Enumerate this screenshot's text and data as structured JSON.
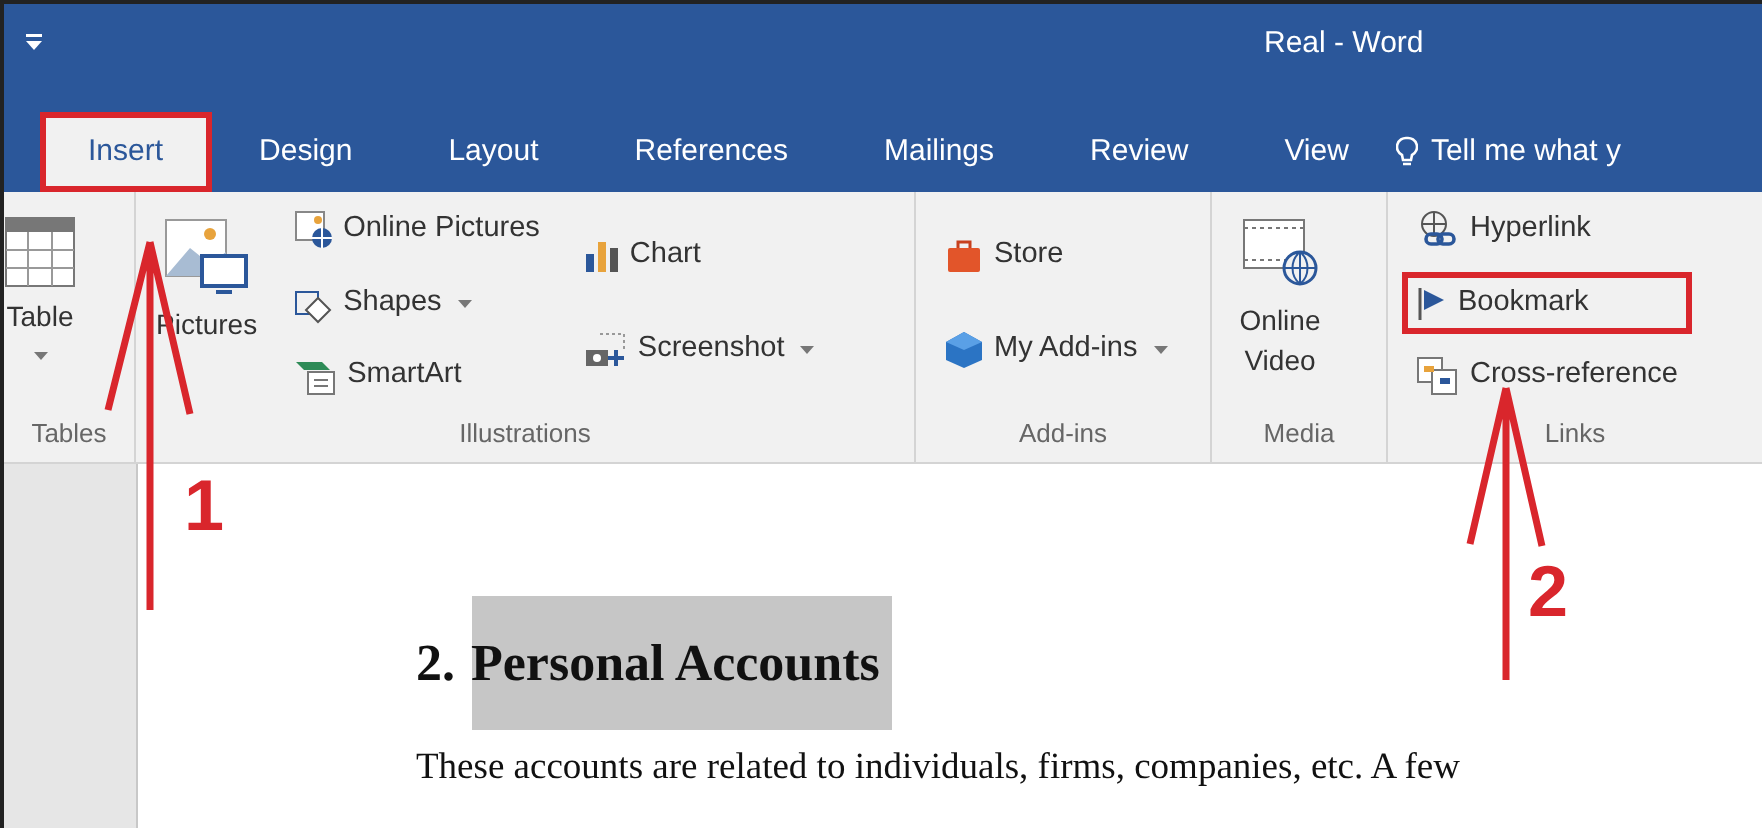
{
  "window": {
    "title": "Real - Word"
  },
  "tabs": [
    {
      "label": "Insert",
      "selected": true,
      "highlighted": true
    },
    {
      "label": "Design",
      "selected": false,
      "highlighted": false
    },
    {
      "label": "Layout",
      "selected": false,
      "highlighted": false
    },
    {
      "label": "References",
      "selected": false,
      "highlighted": false
    },
    {
      "label": "Mailings",
      "selected": false,
      "highlighted": false
    },
    {
      "label": "Review",
      "selected": false,
      "highlighted": false
    },
    {
      "label": "View",
      "selected": false,
      "highlighted": false
    }
  ],
  "tell_me": {
    "label": "Tell me what y"
  },
  "ribbon": {
    "groups": [
      {
        "label": "Tables",
        "columns": [
          [
            {
              "kind": "large",
              "label": "Table",
              "dropdown": true,
              "highlighted": false
            }
          ]
        ]
      },
      {
        "label": "Illustrations",
        "columns": [
          [
            {
              "kind": "large",
              "label": "Pictures",
              "dropdown": false,
              "highlighted": false
            }
          ],
          [
            {
              "kind": "small",
              "label": "Online Pictures",
              "dropdown": false,
              "highlighted": false
            },
            {
              "kind": "small",
              "label": "Shapes",
              "dropdown": true,
              "highlighted": false
            },
            {
              "kind": "small",
              "label": "SmartArt",
              "dropdown": false,
              "highlighted": false
            }
          ],
          [
            {
              "kind": "small",
              "label": "Chart",
              "dropdown": false,
              "highlighted": false
            },
            {
              "kind": "small",
              "label": "Screenshot",
              "dropdown": true,
              "highlighted": false
            }
          ]
        ]
      },
      {
        "label": "Add-ins",
        "columns": [
          [
            {
              "kind": "small",
              "label": "Store",
              "dropdown": false,
              "highlighted": false
            },
            {
              "kind": "small",
              "label": "My Add-ins",
              "dropdown": true,
              "highlighted": false
            }
          ]
        ]
      },
      {
        "label": "Media",
        "columns": [
          [
            {
              "kind": "large",
              "label": "Online Video",
              "dropdown": false,
              "highlighted": false
            }
          ]
        ]
      },
      {
        "label": "Links",
        "columns": [
          [
            {
              "kind": "small",
              "label": "Hyperlink",
              "dropdown": false,
              "highlighted": false
            },
            {
              "kind": "small",
              "label": "Bookmark",
              "dropdown": false,
              "highlighted": true
            },
            {
              "kind": "small",
              "label": "Cross-reference",
              "dropdown": false,
              "highlighted": false
            }
          ]
        ]
      }
    ]
  },
  "document": {
    "heading": {
      "number": "2.",
      "text": "Personal Accounts",
      "selected": true
    },
    "paragraph": "These accounts are related to individuals, firms, companies, etc. A few"
  },
  "annotations": [
    {
      "label": "1"
    },
    {
      "label": "2"
    }
  ]
}
